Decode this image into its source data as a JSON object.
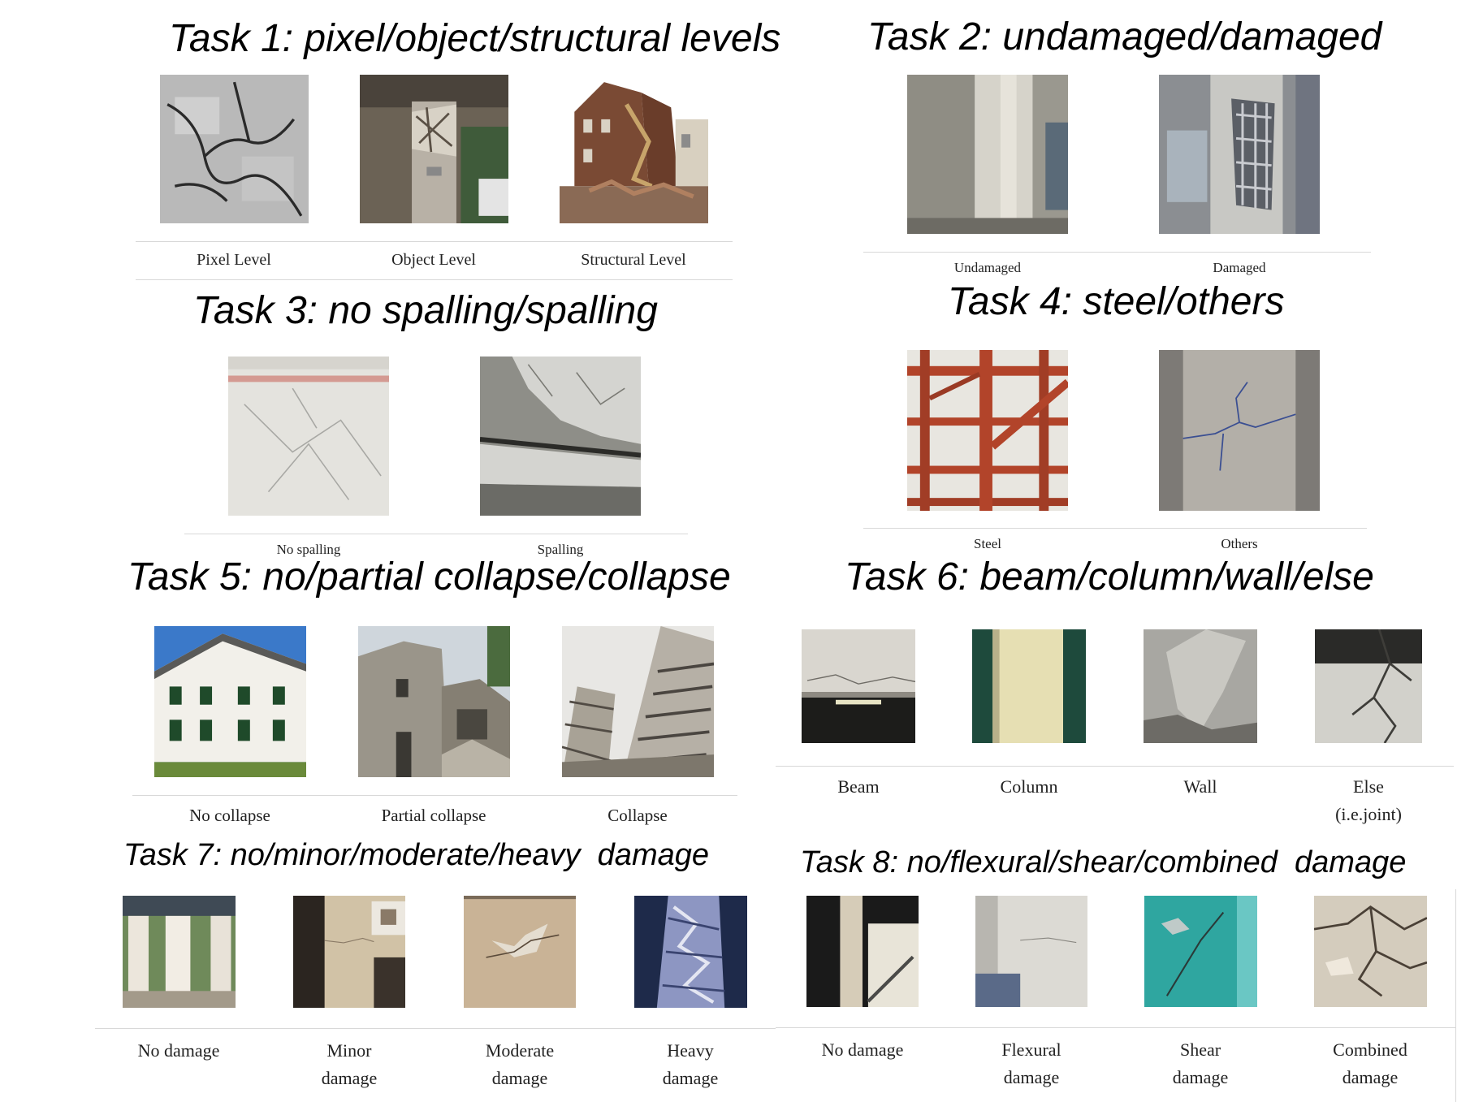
{
  "tasks": [
    {
      "title": "Task 1: pixel/object/structural levels",
      "labels": [
        "Pixel Level",
        "Object Level",
        "Structural Level"
      ]
    },
    {
      "title": "Task 2: undamaged/damaged",
      "labels": [
        "Undamaged",
        "Damaged"
      ]
    },
    {
      "title": "Task 3: no spalling/spalling",
      "labels": [
        "No spalling",
        "Spalling"
      ]
    },
    {
      "title": "Task 4: steel/others",
      "labels": [
        "Steel",
        "Others"
      ]
    },
    {
      "title": "Task 5: no/partial collapse/collapse",
      "labels": [
        "No collapse",
        "Partial collapse",
        "Collapse"
      ]
    },
    {
      "title": "Task 6: beam/column/wall/else",
      "labels": [
        "Beam",
        "Column",
        "Wall",
        "Else\n(i.e.joint)"
      ]
    },
    {
      "title": "Task 7: no/minor/moderate/heavy  damage",
      "labels": [
        "No damage",
        "Minor\ndamage",
        "Moderate\ndamage",
        "Heavy\ndamage"
      ]
    },
    {
      "title": "Task 8: no/flexural/shear/combined  damage",
      "labels": [
        "No damage",
        "Flexural\ndamage",
        "Shear\ndamage",
        "Combined\ndamage"
      ]
    }
  ]
}
